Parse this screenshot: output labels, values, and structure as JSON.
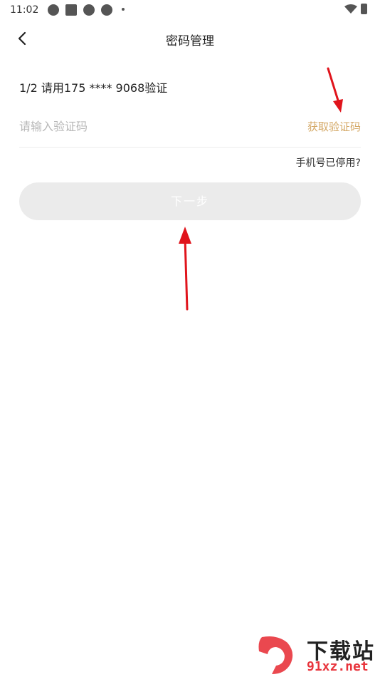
{
  "status_bar": {
    "time": "11:02",
    "icons": [
      "app-round-icon",
      "app-square-icon",
      "app-round-icon",
      "app-round-icon",
      "dot-icon",
      "wifi-icon",
      "battery-icon"
    ]
  },
  "header": {
    "back_icon": "chevron-left-icon",
    "title": "密码管理"
  },
  "step": {
    "text": "1/2 请用175 **** 9068验证"
  },
  "code_input": {
    "placeholder": "请输入验证码",
    "value": ""
  },
  "get_code_label": "获取验证码",
  "phone_disabled_label": "手机号已停用?",
  "next_button_label": "下一步",
  "annotations": {
    "arrow_color": "#e0141c",
    "arrows": [
      "arrow-to-get-code",
      "arrow-to-next-button"
    ]
  },
  "watermark": {
    "logo_text": "9",
    "title": "下载站",
    "url": "91xz.net"
  },
  "colors": {
    "accent": "#d4a866",
    "button_disabled_bg": "#ebebeb"
  }
}
